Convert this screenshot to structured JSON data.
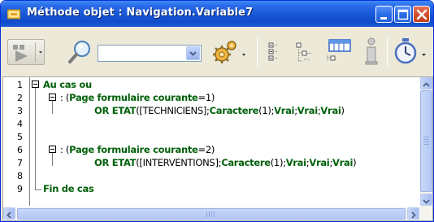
{
  "window": {
    "title": "Méthode objet : Navigation.Variable7"
  },
  "toolbar": {
    "step_icon": "play-step-icon",
    "search_icon": "magnifier-icon",
    "combo_value": "",
    "gear_icon": "gears-icon",
    "info_icon": "info-icon",
    "timer_icon": "stopwatch-icon"
  },
  "editor": {
    "line_numbers": [
      "1",
      "2",
      "3",
      "4",
      "5",
      "6",
      "7",
      "8",
      "9"
    ],
    "lines": {
      "l1": {
        "text": "Au cas ou"
      },
      "l2": {
        "prefix": ": (",
        "keyword": "Page formulaire courante",
        "suffix": "=1)"
      },
      "l3": {
        "fn": "OR ETAT",
        "open": "([",
        "table": "TECHNICIENS",
        "mid": "];",
        "fn2": "Caractere",
        "num": "(1);",
        "v1": "Vrai",
        "s1": ";",
        "v2": "Vrai",
        "s2": ";",
        "v3": "Vrai",
        "close": ")"
      },
      "l5": {
        "prefix": ": (",
        "keyword": "Page formulaire courante",
        "suffix": "=2)"
      },
      "l6": {
        "fn": "OR ETAT",
        "open": "([",
        "table": "INTERVENTIONS",
        "mid": "];",
        "fn2": "Caractere",
        "num": "(1);",
        "v1": "Vrai",
        "s1": ";",
        "v2": "Vrai",
        "s2": ";",
        "v3": "Vrai",
        "close": ")"
      },
      "l8": {
        "text": "Fin de cas"
      }
    }
  },
  "colors": {
    "keyword": "#00600A",
    "titlebar": "#1656D6",
    "chrome": "#ECE9D8"
  }
}
